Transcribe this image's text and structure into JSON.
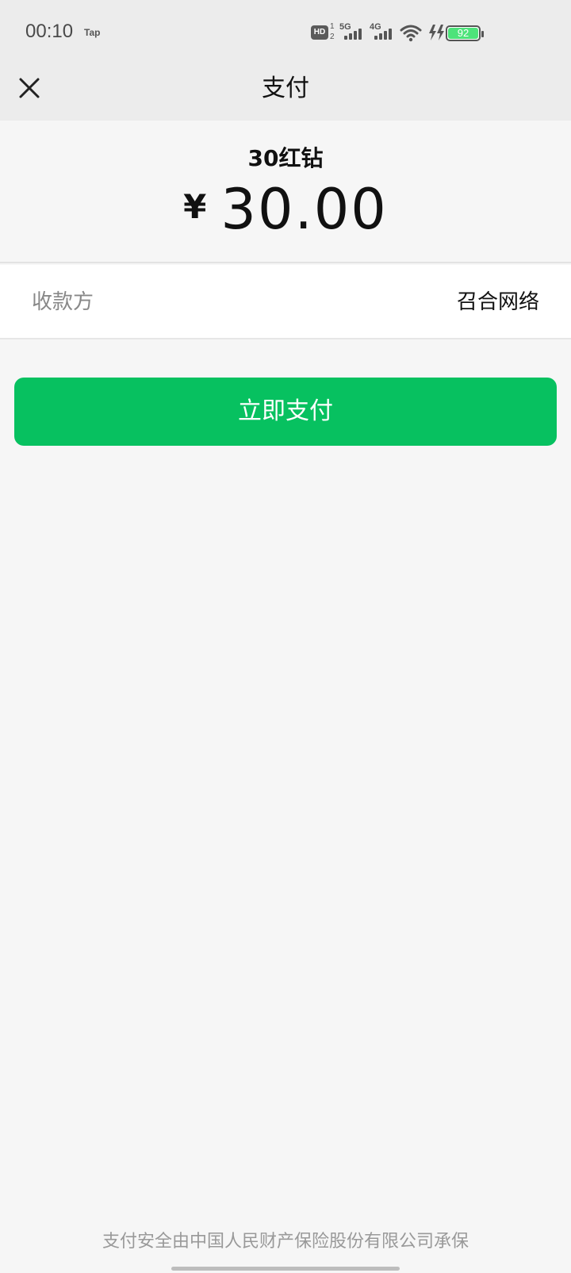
{
  "status_bar": {
    "time": "00:10",
    "tap_label": "Tap",
    "hd_label": "HD",
    "hd_sub_top": "1",
    "hd_sub_bottom": "2",
    "network_1": "5G",
    "network_2": "4G",
    "battery_level": "92"
  },
  "header": {
    "title": "支付",
    "close_icon": "close-icon"
  },
  "order": {
    "product_name": "30红钻",
    "currency_symbol": "¥",
    "amount": "30.00"
  },
  "payee": {
    "label": "收款方",
    "value": "召合网络"
  },
  "actions": {
    "pay_label": "立即支付"
  },
  "footer": {
    "note": "支付安全由中国人民财产保险股份有限公司承保"
  },
  "colors": {
    "primary_green": "#07c160",
    "battery_green": "#4de37a",
    "header_bg": "#ececec",
    "page_bg": "#f6f6f6"
  }
}
